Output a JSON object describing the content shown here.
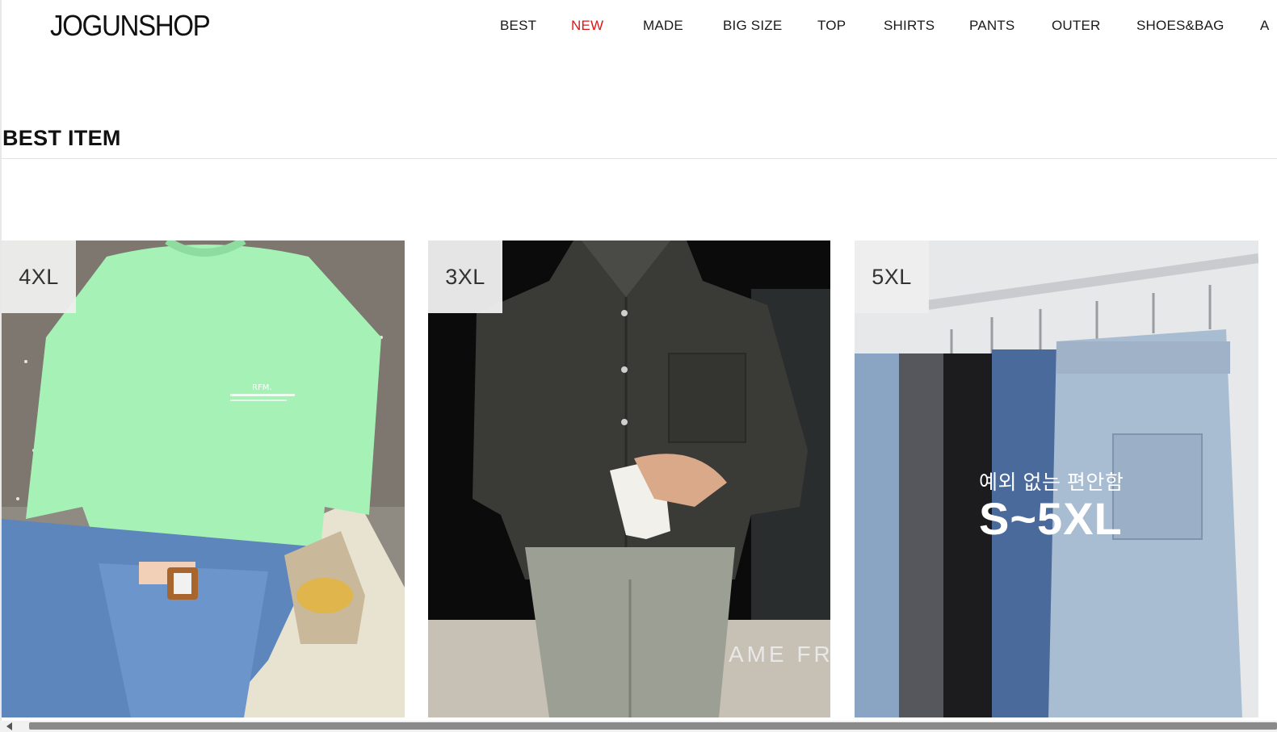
{
  "header": {
    "logo": "JOGUNSHOP",
    "nav": [
      {
        "label": "BEST",
        "active": false
      },
      {
        "label": "NEW",
        "active": true
      },
      {
        "label": "MADE",
        "active": false
      },
      {
        "label": "BIG SIZE",
        "active": false
      },
      {
        "label": "TOP",
        "active": false
      },
      {
        "label": "SHIRTS",
        "active": false
      },
      {
        "label": "PANTS",
        "active": false
      },
      {
        "label": "OUTER",
        "active": false
      },
      {
        "label": "SHOES&BAG",
        "active": false
      },
      {
        "label": "A",
        "active": false
      }
    ]
  },
  "section": {
    "title": "BEST ITEM"
  },
  "products": [
    {
      "badge": "4XL",
      "image": "mint-tshirt-photo",
      "print_text": "RFM."
    },
    {
      "badge": "3XL",
      "image": "dark-shirt-photo",
      "photo_text": "AME FR"
    },
    {
      "badge": "5XL",
      "image": "jeans-rack-photo",
      "promo_sub": "예외 없는 편안함",
      "promo_main": "S~5XL"
    }
  ],
  "colors": {
    "accent": "#e01515",
    "text": "#111111",
    "badge_bg": "#eeeeee"
  }
}
